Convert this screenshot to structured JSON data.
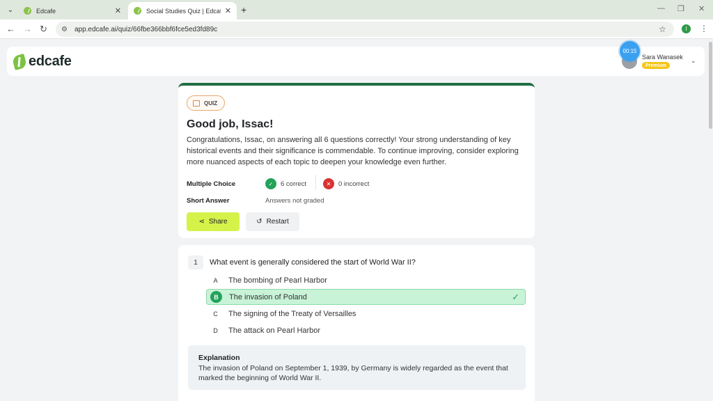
{
  "browser": {
    "tabs": [
      {
        "title": "Edcafe",
        "active": false
      },
      {
        "title": "Social Studies Quiz | Edcafe Qu",
        "active": true
      }
    ],
    "url": "app.edcafe.ai/quiz/66fbe366bbf6fce5ed3fd89c",
    "profile_initial": "I"
  },
  "header": {
    "logo_text": "edcafe",
    "timer": "00:15",
    "user_name": "Sara Wanasek",
    "plan_badge": "Premium"
  },
  "result": {
    "badge": "QUIZ",
    "title": "Good job, Issac!",
    "body": "Congratulations, Issac, on answering all 6 questions correctly! Your strong understanding of key historical events and their significance is commendable. To continue improving, consider exploring more nuanced aspects of each topic to deepen your knowledge even further.",
    "multiple_choice_label": "Multiple Choice",
    "correct_text": "6 correct",
    "incorrect_text": "0 incorrect",
    "short_answer_label": "Short Answer",
    "short_answer_status": "Answers not graded",
    "share_label": "Share",
    "restart_label": "Restart"
  },
  "question": {
    "number": "1",
    "text": "What event is generally considered the start of World War II?",
    "options": [
      {
        "letter": "A",
        "text": "The bombing of Pearl Harbor",
        "correct": false
      },
      {
        "letter": "B",
        "text": "The invasion of Poland",
        "correct": true
      },
      {
        "letter": "C",
        "text": "The signing of the Treaty of Versailles",
        "correct": false
      },
      {
        "letter": "D",
        "text": "The attack on Pearl Harbor",
        "correct": false
      }
    ],
    "explanation_title": "Explanation",
    "explanation_text": "The invasion of Poland on September 1, 1939, by Germany is widely regarded as the event that marked the beginning of World War II."
  },
  "colors": {
    "accent_green": "#1f6e43",
    "share_button": "#d4f24a",
    "correct_bg": "#c8f3d7",
    "correct_dot": "#23a25a",
    "incorrect_dot": "#d93232",
    "premium": "#f5c518"
  }
}
